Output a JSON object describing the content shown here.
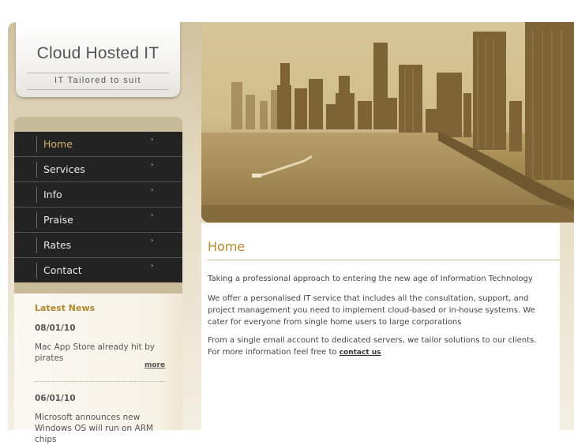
{
  "site": {
    "title": "Cloud Hosted IT",
    "tagline": "IT Tailored to suit"
  },
  "nav": {
    "items": [
      {
        "label": "Home",
        "active": true
      },
      {
        "label": "Services"
      },
      {
        "label": "Info"
      },
      {
        "label": "Praise"
      },
      {
        "label": "Rates"
      },
      {
        "label": "Contact"
      }
    ],
    "arrow_glyph": "›"
  },
  "news": {
    "heading": "Latest News",
    "items": [
      {
        "date": "08/01/10",
        "text": "Mac App Store already hit by pirates",
        "more": "more"
      },
      {
        "date": "06/01/10",
        "text": "Microsoft announces new Windows OS will run on ARM chips"
      }
    ]
  },
  "content": {
    "title": "Home",
    "p1": "Taking a professional approach to entering the new age of Information Technology",
    "p2": "We offer a personalised IT service that includes all the consultation, support, and project management you need to implement cloud-based or in-house systems. We cater for everyone from single home users to large corporations",
    "p3": "From a single email account to dedicated servers, we tailor solutions to our clients. For more information feel free to",
    "contact_link": "contact us"
  },
  "colors": {
    "accent": "#b8892e",
    "nav_bg": "#232323",
    "frame": "#cfc2a0"
  }
}
